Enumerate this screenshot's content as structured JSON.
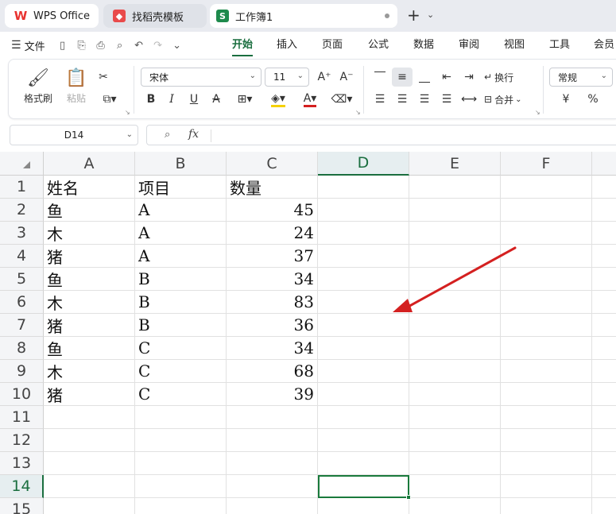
{
  "tabs": [
    {
      "label": "WPS Office",
      "icon": "wps-logo-icon"
    },
    {
      "label": "找稻壳模板",
      "icon": "daoke-icon"
    },
    {
      "label": "工作簿1",
      "icon": "S",
      "modified": true
    }
  ],
  "menu": {
    "file_label": "文件",
    "tabs": [
      "开始",
      "插入",
      "页面",
      "公式",
      "数据",
      "审阅",
      "视图",
      "工具",
      "会员"
    ],
    "active_tab": "开始"
  },
  "ribbon": {
    "format_painter": "格式刷",
    "paste": "粘贴",
    "font_name": "宋体",
    "font_size": "11",
    "wrap_text": "换行",
    "merge": "合并",
    "number_format": "常规",
    "currency_symbol": "¥",
    "percent_symbol": "%"
  },
  "formula_bar": {
    "name_box": "D14",
    "fx_label": "fx",
    "content": ""
  },
  "columns": [
    "A",
    "B",
    "C",
    "D",
    "E",
    "F"
  ],
  "rows": [
    "1",
    "2",
    "3",
    "4",
    "5",
    "6",
    "7",
    "8",
    "9",
    "10",
    "11",
    "12",
    "13",
    "14",
    "15"
  ],
  "cells": [
    [
      "姓名",
      "项目",
      "数量"
    ],
    [
      "鱼",
      "A",
      "45"
    ],
    [
      "木",
      "A",
      "24"
    ],
    [
      "猪",
      "A",
      "37"
    ],
    [
      "鱼",
      "B",
      "34"
    ],
    [
      "木",
      "B",
      "83"
    ],
    [
      "猪",
      "B",
      "36"
    ],
    [
      "鱼",
      "C",
      "34"
    ],
    [
      "木",
      "C",
      "68"
    ],
    [
      "猪",
      "C",
      "39"
    ]
  ],
  "active_cell": "D14",
  "colors": {
    "accent": "#1a6e3f",
    "arrow": "#d42020"
  }
}
